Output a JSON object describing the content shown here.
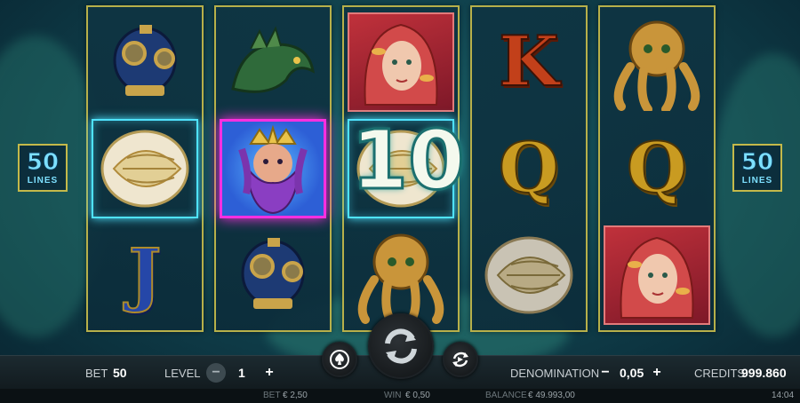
{
  "game": {
    "reels": [
      {
        "symbols": [
          "diving-helmet",
          "conch-shell",
          "jack"
        ]
      },
      {
        "symbols": [
          "sea-dragon",
          "poseidon",
          "diving-helmet"
        ]
      },
      {
        "symbols": [
          "mermaid",
          "conch-shell",
          "octopus"
        ]
      },
      {
        "symbols": [
          "king",
          "queen",
          "conch-shell"
        ]
      },
      {
        "symbols": [
          "octopus",
          "queen",
          "mermaid"
        ]
      }
    ],
    "letters": {
      "jack": "J",
      "queen": "Q",
      "king": "K"
    },
    "win_amount": "10",
    "lines_left": {
      "value": "50",
      "label": "LINES"
    },
    "lines_right": {
      "value": "50",
      "label": "LINES"
    },
    "colors": {
      "win_highlight": "#4fe3ff",
      "wild_highlight": "#ff2fe0",
      "reel_border": "#b7b04a"
    }
  },
  "controls": {
    "bet_label": "BET",
    "bet_value": "50",
    "level_label": "LEVEL",
    "level_value": "1",
    "level_minus": "−",
    "level_plus": "+",
    "denomination_label": "DENOMINATION",
    "denomination_value": "0,05",
    "denomination_minus": "−",
    "denomination_plus": "+",
    "credits_label": "CREDITS",
    "credits_value": "999.860",
    "autoplay_icon": "spade-chip-icon",
    "spin_icon": "spin-arrows-icon",
    "quickspin_icon": "fast-spin-icon"
  },
  "status_bar": {
    "bet_label": "BET",
    "bet_value": "€ 2,50",
    "win_label": "WIN",
    "win_value": "€ 0,50",
    "balance_label": "BALANCE",
    "balance_value": "€ 49.993,00",
    "time": "14:04"
  }
}
